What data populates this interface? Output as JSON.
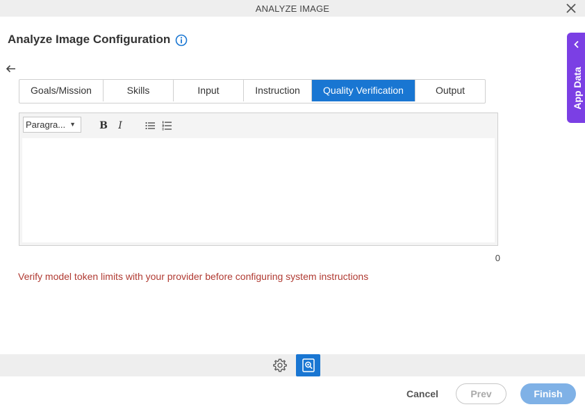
{
  "window": {
    "title": "ANALYZE IMAGE",
    "close_icon": "close-icon"
  },
  "page": {
    "title": "Analyze Image Configuration",
    "info_icon": "info-icon",
    "back_icon": "back-arrow-icon"
  },
  "tabs": [
    {
      "label": "Goals/Mission",
      "active": false
    },
    {
      "label": "Skills",
      "active": false
    },
    {
      "label": "Input",
      "active": false
    },
    {
      "label": "Instruction",
      "active": false
    },
    {
      "label": "Quality Verification",
      "active": true
    },
    {
      "label": "Output",
      "active": false
    }
  ],
  "editor": {
    "format_value": "Paragra...",
    "bold_label": "B",
    "italic_label": "I",
    "bullet_list_icon": "bullet-list-icon",
    "numbered_list_icon": "numbered-list-icon",
    "content": "",
    "char_count": "0"
  },
  "warning": "Verify model token limits with your provider before configuring system instructions",
  "footer": {
    "settings_icon": "gear-icon",
    "verify_icon": "image-search-icon",
    "cancel_label": "Cancel",
    "prev_label": "Prev",
    "finish_label": "Finish"
  },
  "side_panel": {
    "label": "App Data",
    "icon": "chevron-left-icon"
  },
  "colors": {
    "accent": "#1976d2",
    "side_panel": "#7b3fe4",
    "warning_text": "#b03a32",
    "finish_disabled": "#7fb1e6"
  }
}
